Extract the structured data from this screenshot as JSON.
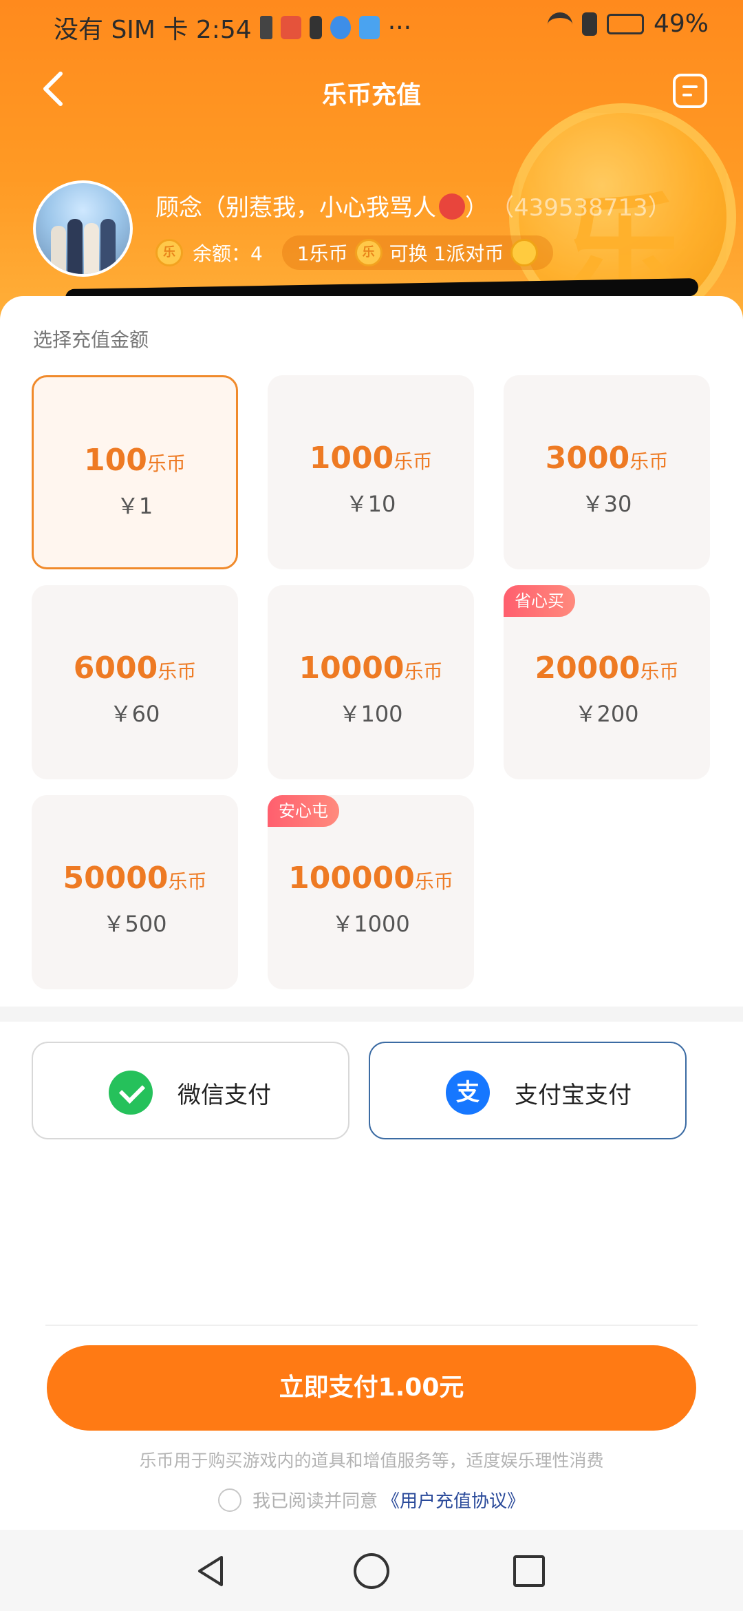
{
  "status_bar": {
    "carrier_time": "没有 SIM 卡 2:54",
    "more": "···",
    "battery": "49%"
  },
  "nav": {
    "title": "乐币充值"
  },
  "profile": {
    "name": "顾念（别惹我，小心我骂人",
    "name_close": "）",
    "user_id": "（439538713）",
    "coin_glyph": "乐",
    "balance": "余额：4",
    "rate_left": "1乐币",
    "rate_right": "可换 1派对币"
  },
  "select": {
    "title": "选择充值金额",
    "unit": "乐币",
    "options": [
      {
        "amount": "100",
        "price": "￥1",
        "badge": ""
      },
      {
        "amount": "1000",
        "price": "￥10",
        "badge": ""
      },
      {
        "amount": "3000",
        "price": "￥30",
        "badge": ""
      },
      {
        "amount": "6000",
        "price": "￥60",
        "badge": ""
      },
      {
        "amount": "10000",
        "price": "￥100",
        "badge": ""
      },
      {
        "amount": "20000",
        "price": "￥200",
        "badge": "省心买"
      },
      {
        "amount": "50000",
        "price": "￥500",
        "badge": ""
      },
      {
        "amount": "100000",
        "price": "￥1000",
        "badge": "安心屯"
      }
    ]
  },
  "payment": {
    "wechat": "微信支付",
    "alipay": "支付宝支付",
    "alipay_glyph": "支"
  },
  "footer": {
    "pay_button": "立即支付1.00元",
    "notice": "乐币用于购买游戏内的道具和增值服务等，适度娱乐理性消费",
    "agree_text": "我已阅读并同意",
    "agree_link": "《用户充值协议》"
  },
  "colors": {
    "accent": "#ff7a14",
    "amount_text": "#ee7a23",
    "badge": "#ff6b72"
  }
}
